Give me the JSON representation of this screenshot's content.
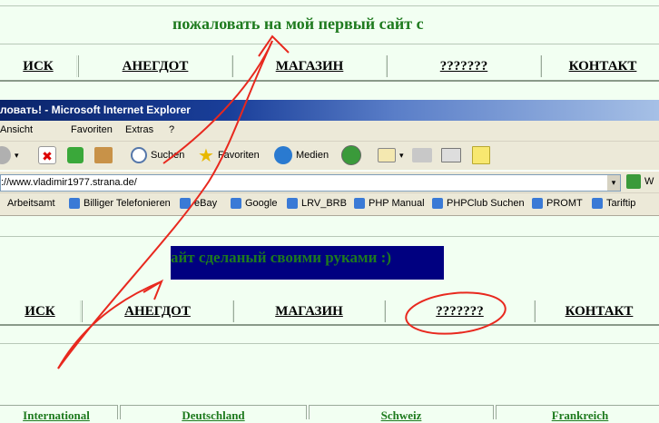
{
  "top_page": {
    "welcome_heading": "пожаловать на мой первый сайт с",
    "nav": [
      "ИСК",
      "АНЕГДОТ",
      "МАГАЗИН",
      "???????",
      "КОНТАКТ"
    ]
  },
  "ie_window": {
    "title": "ловать! - Microsoft Internet Explorer",
    "menu": [
      "Ansicht",
      "Favoriten",
      "Extras",
      "?"
    ],
    "toolbar": {
      "search": "Suchen",
      "favorites": "Favoriten",
      "media": "Medien"
    },
    "address": "://www.vladimir1977.strana.de/",
    "go_label": "W",
    "links": [
      "Arbeitsamt",
      "Billiger Telefonieren",
      "eBay",
      "Google",
      "LRV_BRB",
      "PHP Manual",
      "PHPClub Suchen",
      "PROMT",
      "Tariftip"
    ]
  },
  "inner_page": {
    "banner_text": "айт сделаный своими руками :)",
    "nav": [
      "ИСК",
      "АНЕГДОТ",
      "МАГАЗИН",
      "???????",
      "КОНТАКТ"
    ],
    "bottom_tabs": [
      "International",
      "Deutschland",
      "Schweiz",
      "Frankreich"
    ]
  },
  "colors": {
    "heading_green": "#1e7a1e",
    "banner_bg": "#000080",
    "annotation_red": "#e8281e",
    "page_bg": "#f2fff2"
  }
}
